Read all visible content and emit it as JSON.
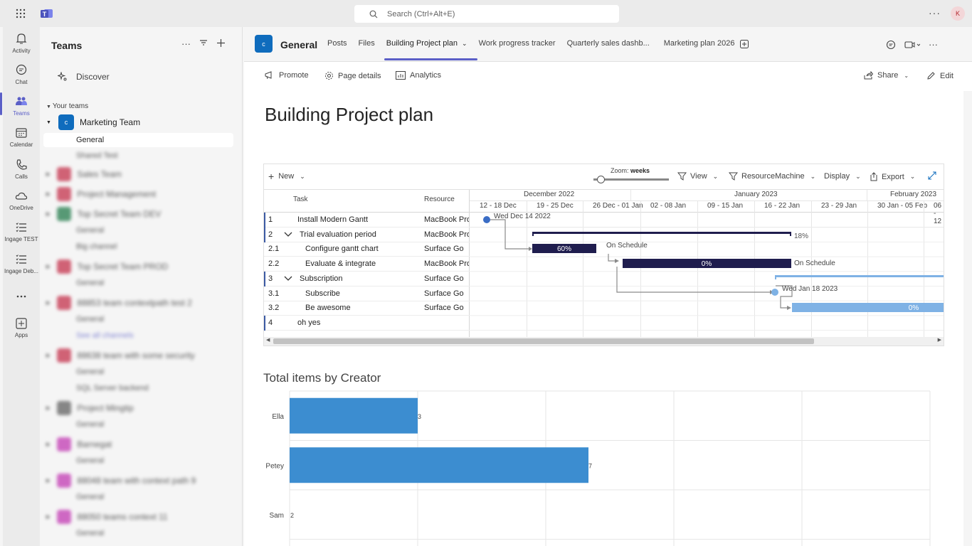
{
  "top": {
    "search_placeholder": "Search (Ctrl+Alt+E)",
    "more": "···",
    "avatar_initials": "K"
  },
  "rail": [
    {
      "label": "Activity",
      "icon": "bell-icon"
    },
    {
      "label": "Chat",
      "icon": "chat-icon"
    },
    {
      "label": "Teams",
      "icon": "teams-icon",
      "active": true
    },
    {
      "label": "Calendar",
      "icon": "calendar-icon"
    },
    {
      "label": "Calls",
      "icon": "phone-icon"
    },
    {
      "label": "OneDrive",
      "icon": "cloud-icon"
    },
    {
      "label": "Ingage TEST",
      "icon": "list-icon"
    },
    {
      "label": "Ingage Deb...",
      "icon": "list-icon"
    },
    {
      "label": "...",
      "icon": "more-icon"
    },
    {
      "label": "Apps",
      "icon": "apps-icon"
    }
  ],
  "sidebar": {
    "title": "Teams",
    "discover": "Discover",
    "your_teams": "Your teams",
    "team": {
      "name": "Marketing Team",
      "initial": "c"
    },
    "channels": [
      "General",
      "Shared Test"
    ],
    "blurred_teams": [
      {
        "name": "Sales Team",
        "color": "#c4314b",
        "channels": []
      },
      {
        "name": "Project Management",
        "color": "#c4314b",
        "channels": []
      },
      {
        "name": "Top Secret Team DEV",
        "color": "#237b4b",
        "channels": [
          "General",
          "Big channel"
        ]
      },
      {
        "name": "Top Secret Team PROD",
        "color": "#c4314b",
        "channels": [
          "General"
        ]
      },
      {
        "name": "88853 team contextpath test 2",
        "color": "#c4314b",
        "channels": [
          "General",
          "See all channels"
        ]
      },
      {
        "name": "88638 team with some security",
        "color": "#c4314b",
        "channels": [
          "General",
          "SQL Server backend"
        ]
      },
      {
        "name": "Project Mingtip",
        "color": "#616161",
        "channels": [
          "General"
        ]
      },
      {
        "name": "Barnegat",
        "color": "#c239b3",
        "channels": [
          "General"
        ]
      },
      {
        "name": "88048 team with context path 9",
        "color": "#c239b3",
        "channels": [
          "General"
        ]
      },
      {
        "name": "88050 teams context 11",
        "color": "#c239b3",
        "channels": [
          "General"
        ]
      }
    ]
  },
  "header": {
    "channel_initial": "c",
    "channel": "General",
    "tabs": [
      "Posts",
      "Files",
      "Building Project plan",
      "Work progress tracker",
      "Quarterly sales dashb...",
      "Marketing plan 2026"
    ],
    "active_tab": "Building Project plan"
  },
  "cmdbar": {
    "promote": "Promote",
    "page_details": "Page details",
    "analytics": "Analytics",
    "share": "Share",
    "edit": "Edit"
  },
  "page": {
    "title": "Building Project plan"
  },
  "gantt": {
    "toolbar": {
      "new": "New",
      "zoom_label": "Zoom:",
      "zoom_value": "weeks",
      "view": "View",
      "resource": "ResourceMachine",
      "display": "Display",
      "export": "Export"
    },
    "columns": {
      "task": "Task",
      "resource": "Resource"
    },
    "months": [
      "December 2022",
      "January 2023",
      "February 2023"
    ],
    "weeks": [
      "12 - 18 Dec",
      "19 - 25 Dec",
      "26 Dec - 01 Jan",
      "02 - 08 Jan",
      "09 - 15 Jan",
      "16 - 22 Jan",
      "23 - 29 Jan",
      "30 Jan - 05 Feb",
      "06 - 12"
    ],
    "rows": [
      {
        "num": "1",
        "task": "Install Modern Gantt",
        "resource": "MacBook Pro",
        "indent": 0,
        "bold": false,
        "toggle": false
      },
      {
        "num": "2",
        "task": "Trial evaluation period",
        "resource": "MacBook Pro",
        "indent": 0,
        "bold": true,
        "toggle": true
      },
      {
        "num": "2.1",
        "task": "Configure gantt chart",
        "resource": "Surface Go",
        "indent": 1,
        "bold": false,
        "toggle": false
      },
      {
        "num": "2.2",
        "task": "Evaluate & integrate",
        "resource": "MacBook Pro",
        "indent": 1,
        "bold": false,
        "toggle": false
      },
      {
        "num": "3",
        "task": "Subscription",
        "resource": "Surface Go",
        "indent": 0,
        "bold": true,
        "toggle": true
      },
      {
        "num": "3.1",
        "task": "Subscribe",
        "resource": "Surface Go",
        "indent": 1,
        "bold": false,
        "toggle": false
      },
      {
        "num": "3.2",
        "task": "Be awesome",
        "resource": "Surface Go",
        "indent": 1,
        "bold": false,
        "toggle": false
      },
      {
        "num": "4",
        "task": "oh yes",
        "resource": "",
        "indent": 0,
        "bold": true,
        "toggle": false
      }
    ],
    "labels": {
      "milestone1": "Wed Dec 14 2022",
      "summary2": "18%",
      "bar21": "60%",
      "status21": "On Schedule",
      "bar22": "0%",
      "status22": "On Schedule",
      "milestone31": "Wed Jan 18 2023",
      "bar32": "0%"
    },
    "colors": {
      "dark": "#1f1d4e",
      "light": "#7fb2e5"
    }
  },
  "chart_title": "Total items by Creator",
  "chart_data": {
    "type": "bar",
    "orientation": "horizontal",
    "title": "Total items by Creator",
    "categories": [
      "Ella",
      "Petey",
      "Sam"
    ],
    "values": [
      3,
      7,
      2
    ],
    "value_labels": [
      "3",
      "7",
      "2"
    ],
    "color": "#3c8dd0",
    "xlim": [
      0,
      15
    ],
    "grid": true
  }
}
